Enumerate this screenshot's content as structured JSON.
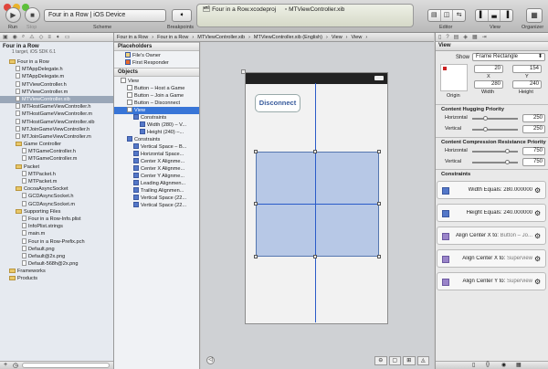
{
  "toolbar": {
    "run": "Run",
    "stop": "Stop",
    "scheme_caption": "Scheme",
    "scheme_value": "Four in a Row | iOS Device",
    "breakpoints": "Breakpoints",
    "editor": "Editor",
    "view": "View",
    "organizer": "Organizer"
  },
  "window": {
    "tab1": "Four in a Row.xcodeproj",
    "tab2": "MTViewController.xib"
  },
  "navigator": {
    "project": "Four in a Row",
    "project_sub": "1 target, iOS SDK 6.1",
    "items": [
      {
        "label": "Four in a Row",
        "kind": "folder",
        "indent": 1
      },
      {
        "label": "MTAppDelegate.h",
        "kind": "file",
        "indent": 2
      },
      {
        "label": "MTAppDelegate.m",
        "kind": "file",
        "indent": 2
      },
      {
        "label": "MTViewController.h",
        "kind": "file",
        "indent": 2
      },
      {
        "label": "MTViewController.m",
        "kind": "file",
        "indent": 2
      },
      {
        "label": "MTViewController.xib",
        "kind": "file",
        "indent": 2,
        "selected": true
      },
      {
        "label": "MTHostGameViewController.h",
        "kind": "file",
        "indent": 2
      },
      {
        "label": "MTHostGameViewController.m",
        "kind": "file",
        "indent": 2
      },
      {
        "label": "MTHostGameViewController.xib",
        "kind": "file",
        "indent": 2
      },
      {
        "label": "MTJoinGameViewController.h",
        "kind": "file",
        "indent": 2
      },
      {
        "label": "MTJoinGameViewController.m",
        "kind": "file",
        "indent": 2
      },
      {
        "label": "Game Controller",
        "kind": "folder",
        "indent": 2
      },
      {
        "label": "MTGameController.h",
        "kind": "file",
        "indent": 3
      },
      {
        "label": "MTGameController.m",
        "kind": "file",
        "indent": 3
      },
      {
        "label": "Packet",
        "kind": "folder",
        "indent": 2
      },
      {
        "label": "MTPacket.h",
        "kind": "file",
        "indent": 3
      },
      {
        "label": "MTPacket.m",
        "kind": "file",
        "indent": 3
      },
      {
        "label": "CocoaAsyncSocket",
        "kind": "folder",
        "indent": 2
      },
      {
        "label": "GCDAsyncSocket.h",
        "kind": "file",
        "indent": 3
      },
      {
        "label": "GCDAsyncSocket.m",
        "kind": "file",
        "indent": 3
      },
      {
        "label": "Supporting Files",
        "kind": "folder",
        "indent": 2
      },
      {
        "label": "Four in a Row-Info.plist",
        "kind": "file",
        "indent": 3
      },
      {
        "label": "InfoPlist.strings",
        "kind": "file",
        "indent": 3
      },
      {
        "label": "main.m",
        "kind": "file",
        "indent": 3
      },
      {
        "label": "Four in a Row-Prefix.pch",
        "kind": "file",
        "indent": 3
      },
      {
        "label": "Default.png",
        "kind": "file",
        "indent": 3
      },
      {
        "label": "Default@2x.png",
        "kind": "file",
        "indent": 3
      },
      {
        "label": "Default-568h@2x.png",
        "kind": "file",
        "indent": 3
      },
      {
        "label": "Frameworks",
        "kind": "folder",
        "indent": 1
      },
      {
        "label": "Products",
        "kind": "folder",
        "indent": 1
      }
    ]
  },
  "jumpbar": [
    "Four in a Row",
    "Four in a Row",
    "MTViewController.xib",
    "MTViewController.xib (English)",
    "View",
    "View"
  ],
  "outline": {
    "placeholders": "Placeholders",
    "placeholder_items": [
      "File's Owner",
      "First Responder"
    ],
    "objects": "Objects",
    "items": [
      {
        "label": "View",
        "indent": 1
      },
      {
        "label": "Button – Host a Game",
        "indent": 2
      },
      {
        "label": "Button – Join a Game",
        "indent": 2
      },
      {
        "label": "Button – Disconnect",
        "indent": 2
      },
      {
        "label": "View",
        "indent": 2,
        "selected": true
      },
      {
        "label": "Constraints",
        "indent": 3
      },
      {
        "label": "Width (280) – V...",
        "indent": 4
      },
      {
        "label": "Height (240) –...",
        "indent": 4
      },
      {
        "label": "Constraints",
        "indent": 2
      },
      {
        "label": "Vertical Space – B...",
        "indent": 3
      },
      {
        "label": "Horizontal Space...",
        "indent": 3
      },
      {
        "label": "Center X Alignme...",
        "indent": 3
      },
      {
        "label": "Center X Alignme...",
        "indent": 3
      },
      {
        "label": "Center Y Alignme...",
        "indent": 3
      },
      {
        "label": "Leading Alignmen...",
        "indent": 3
      },
      {
        "label": "Trailing Alignmen...",
        "indent": 3
      },
      {
        "label": "Vertical Space (22...",
        "indent": 3
      },
      {
        "label": "Vertical Space (22...",
        "indent": 3
      }
    ]
  },
  "canvas": {
    "disconnect_button": "Disconnect"
  },
  "inspector": {
    "title": "View",
    "show_label": "Show",
    "show_value": "Frame Rectangle",
    "origin_label": "Origin",
    "x_value": "20",
    "y_value": "154",
    "x_label": "X",
    "y_label": "Y",
    "width_value": "280",
    "height_value": "240",
    "width_label": "Width",
    "height_label": "Height",
    "hugging_title": "Content Hugging Priority",
    "hugging_h_label": "Horizontal",
    "hugging_h_value": "250",
    "hugging_v_label": "Vertical",
    "hugging_v_value": "250",
    "compression_title": "Content Compression Resistance Priority",
    "comp_h_label": "Horizontal",
    "comp_h_value": "750",
    "comp_v_label": "Vertical",
    "comp_v_value": "750",
    "constraints_title": "Constraints",
    "constraints": [
      {
        "label": "Width Equals:",
        "value": "280.000000"
      },
      {
        "label": "Height Equals:",
        "value": "240.000000"
      },
      {
        "label": "Align Center X to:",
        "value": "Button – Jo..."
      },
      {
        "label": "Align Center X to:",
        "value": "Superview"
      },
      {
        "label": "Align Center Y to:",
        "value": "Superview"
      }
    ]
  },
  "colors": {
    "selection": "#3875d7",
    "constraint_blue": "#2a5bc8",
    "view_fill": "#b7c8e6"
  }
}
